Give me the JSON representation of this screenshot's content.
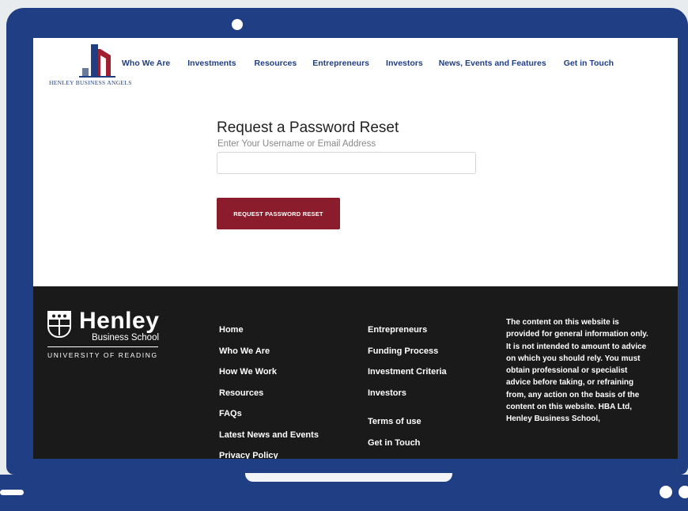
{
  "header": {
    "logo_text": "HENLEY BUSINESS ANGELS",
    "nav": [
      {
        "label": "Who We Are"
      },
      {
        "label": "Investments"
      },
      {
        "label": "Resources"
      },
      {
        "label": "Entrepreneurs"
      },
      {
        "label": "Investors"
      },
      {
        "label": "News, Events and Features"
      },
      {
        "label": "Get in Touch"
      }
    ]
  },
  "form": {
    "title": "Request a Password Reset",
    "label": "Enter Your Username or Email Address",
    "input_value": "",
    "button_label": "REQUEST PASSWORD RESET"
  },
  "footer": {
    "logo": {
      "name": "Henley",
      "sub": "Business School",
      "university": "UNIVERSITY OF READING"
    },
    "col1": [
      {
        "label": "Home"
      },
      {
        "label": "Who We Are"
      },
      {
        "label": "How We Work"
      },
      {
        "label": "Resources"
      },
      {
        "label": "FAQs"
      },
      {
        "label": "Latest News and Events"
      },
      {
        "label": "Privacy Policy"
      }
    ],
    "col2": [
      {
        "label": "Entrepreneurs"
      },
      {
        "label": "Funding Process"
      },
      {
        "label": "Investment Criteria"
      },
      {
        "label": "Investors"
      },
      {
        "label": "Terms of use"
      },
      {
        "label": "Get in Touch"
      }
    ],
    "disclaimer": "The content on this website is provided for general information only. It is not intended to amount to advice on which you should rely. You must obtain professional or specialist advice before taking, or refraining from, any action on the basis of the content on this website. HBA Ltd, Henley Business School,"
  },
  "colors": {
    "frame": "#1f3e84",
    "nav": "#1f3e84",
    "button": "#8a1c2b",
    "footer": "#1a1a1a"
  }
}
